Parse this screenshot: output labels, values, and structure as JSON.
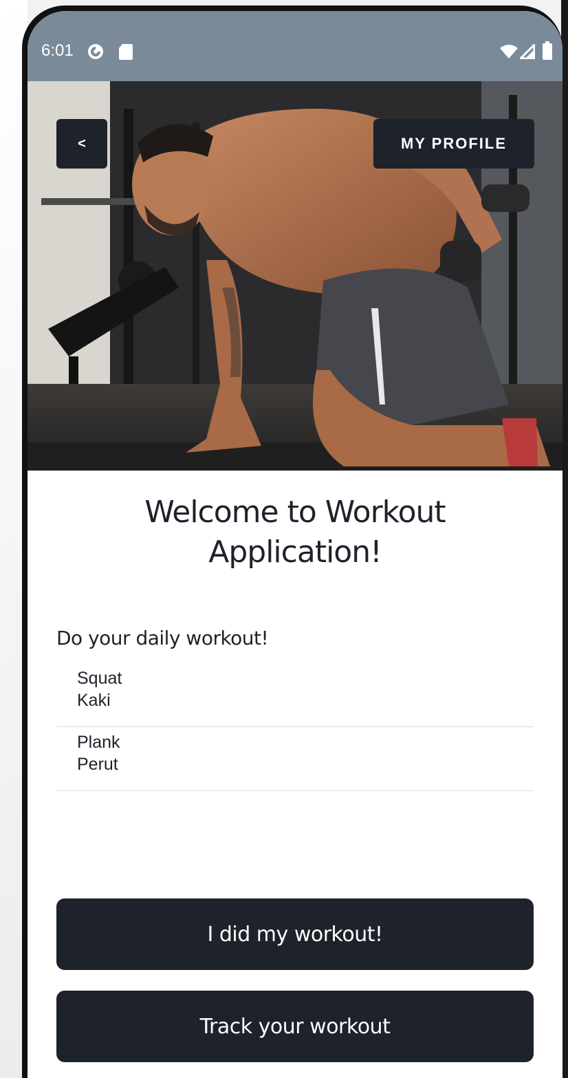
{
  "status_bar": {
    "time": "6:01",
    "bg_color": "#7a8a99",
    "icons": [
      "app-notification-icon",
      "sd-card-icon",
      "wifi-icon",
      "signal-icon",
      "battery-icon"
    ]
  },
  "header": {
    "back_label": "<",
    "profile_label": "MY PROFILE"
  },
  "main": {
    "title": "Welcome to Workout Application!",
    "subtitle": "Do your daily workout!",
    "workouts": [
      {
        "name": "Squat",
        "part": "Kaki"
      },
      {
        "name": "Plank",
        "part": "Perut"
      }
    ]
  },
  "actions": {
    "did_workout_label": "I did my workout!",
    "track_workout_label": "Track your workout"
  },
  "colors": {
    "primary": "#1e222a",
    "background": "#ffffff",
    "divider": "#dcdcdc"
  }
}
